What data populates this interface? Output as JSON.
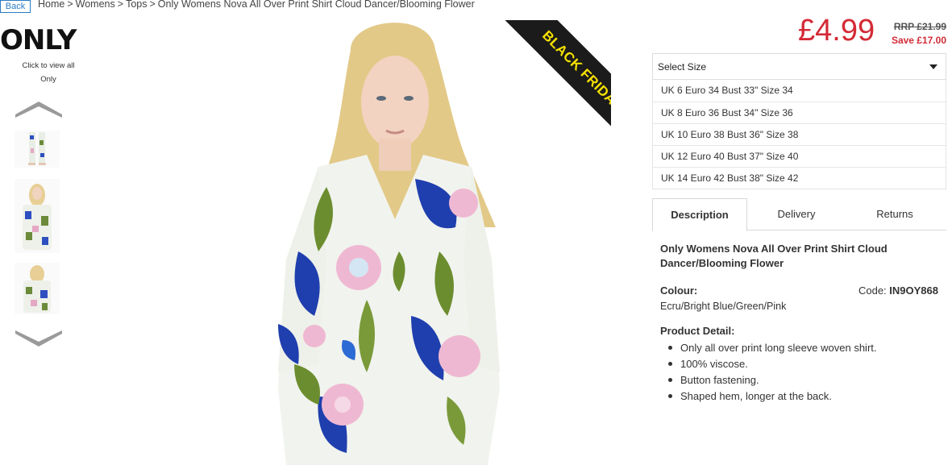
{
  "nav": {
    "back_label": "Back",
    "breadcrumb": [
      "Home",
      "Womens",
      "Tops",
      "Only Womens Nova All Over Print Shirt Cloud Dancer/Blooming Flower"
    ],
    "separator": ">"
  },
  "brand": {
    "logo_text": "ONLY",
    "caption_line1": "Click to view all",
    "caption_line2": "Only"
  },
  "ribbon": {
    "text": "BLACK FRIDAY",
    "background": "#1b1b1b",
    "color": "#f5e100"
  },
  "pricing": {
    "price": "£4.99",
    "rrp": "RRP £21.99",
    "save": "Save £17.00",
    "price_color": "#d42a36"
  },
  "size_select": {
    "label": "Select Size",
    "options": [
      "UK 6 Euro 34 Bust 33\" Size 34",
      "UK 8 Euro 36 Bust 34\" Size 36",
      "UK 10 Euro 38 Bust 36\" Size 38",
      "UK 12 Euro 40 Bust 37\" Size 40",
      "UK 14 Euro 42 Bust 38\" Size 42"
    ]
  },
  "tabs": [
    {
      "label": "Description",
      "active": true
    },
    {
      "label": "Delivery",
      "active": false
    },
    {
      "label": "Returns",
      "active": false
    }
  ],
  "description": {
    "title": "Only Womens Nova All Over Print Shirt Cloud Dancer/Blooming Flower",
    "colour_label": "Colour:",
    "colour_value": "Ecru/Bright Blue/Green/Pink",
    "code_label": "Code:",
    "code_value": "IN9OY868",
    "detail_label": "Product Detail:",
    "details": [
      "Only all over print long sleeve woven shirt.",
      "100% viscose.",
      "Button fastening.",
      "Shaped hem, longer at the back."
    ]
  }
}
